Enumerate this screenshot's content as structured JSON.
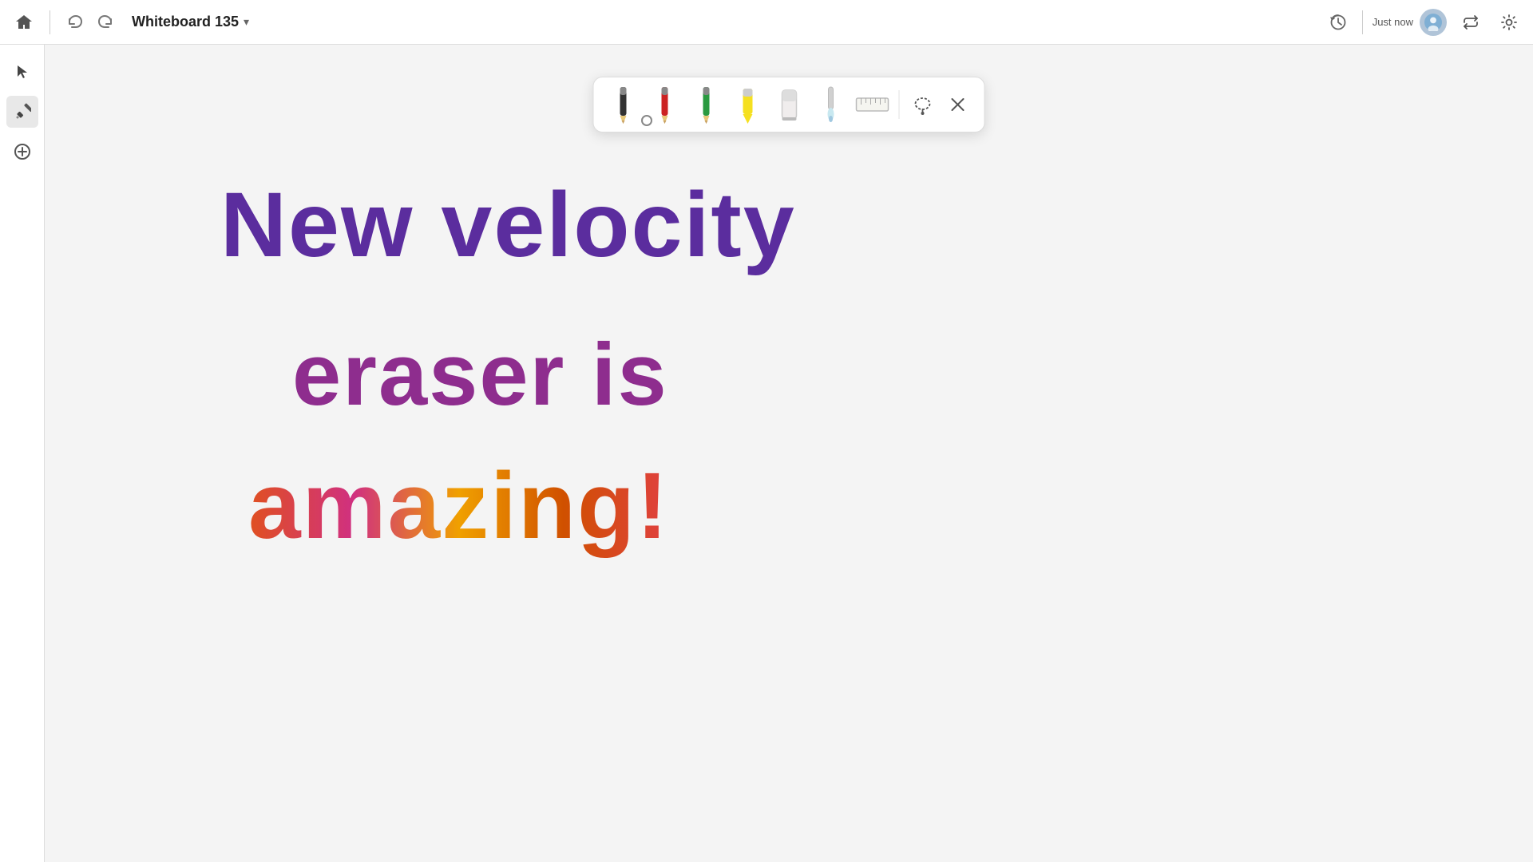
{
  "topbar": {
    "title": "Whiteboard 135",
    "save_status": "Just now",
    "home_icon": "⌂",
    "undo_icon": "↩",
    "redo_icon": "↪",
    "chevron_icon": "▾",
    "clock_icon": "🕐",
    "share_icon": "⤴",
    "settings_icon": "⚙"
  },
  "sidebar": {
    "select_tool_label": "Select",
    "draw_tool_label": "Draw",
    "add_tool_label": "Add"
  },
  "palette": {
    "pencil_black_label": "Black pencil",
    "pencil_red_label": "Red pencil",
    "pencil_green_label": "Green pencil",
    "pencil_yellow_label": "Yellow highlighter",
    "eraser_label": "Eraser",
    "brush_label": "Brush",
    "ruler_label": "Ruler",
    "lasso_label": "Lasso select",
    "close_label": "Close palette"
  },
  "canvas": {
    "line1": "New  velocity",
    "line2": "eraser is",
    "line3": "amazing!"
  }
}
